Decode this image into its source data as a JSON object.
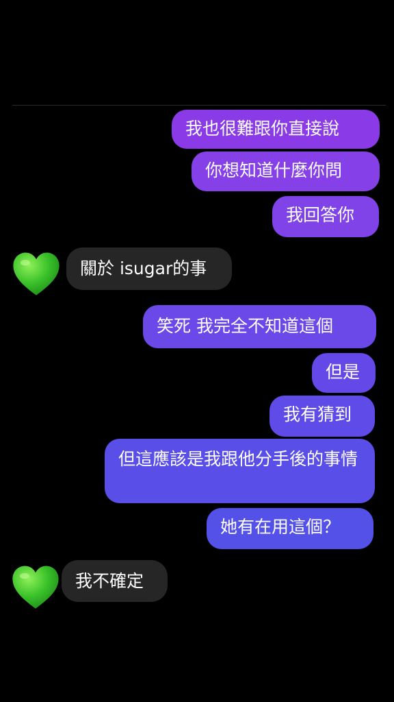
{
  "thread": {
    "accent_gradient_top": "#8b3be8",
    "accent_gradient_bottom": "#4f55e6",
    "received_bubble_color": "#262626",
    "avatar_icon": "green-heart-icon",
    "messages": [
      {
        "from": "me",
        "text": "我也很難跟你直接說"
      },
      {
        "from": "me",
        "text": "你想知道什麼你問"
      },
      {
        "from": "me",
        "text": "我回答你"
      },
      {
        "from": "them",
        "text": "關於 isugar的事"
      },
      {
        "from": "me",
        "text": "笑死 我完全不知道這個"
      },
      {
        "from": "me",
        "text": "但是"
      },
      {
        "from": "me",
        "text": "我有猜到"
      },
      {
        "from": "me",
        "text": "但這應該是我跟他分手後的事情"
      },
      {
        "from": "me",
        "text": "她有在用這個？"
      },
      {
        "from": "them",
        "text": "我不確定"
      }
    ]
  }
}
